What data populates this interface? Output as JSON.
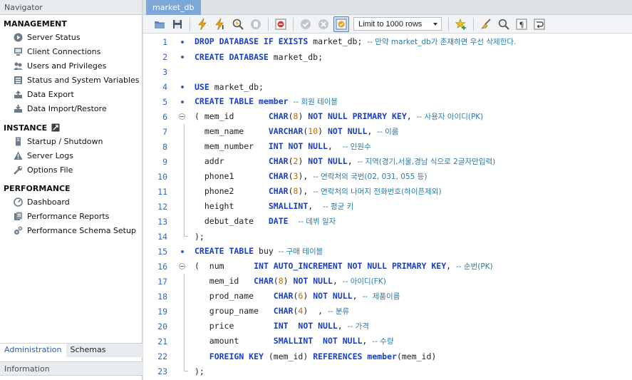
{
  "navigator": {
    "title": "Navigator",
    "sections": [
      {
        "label": "MANAGEMENT",
        "items": [
          {
            "label": "Server Status",
            "icon": "play-icon"
          },
          {
            "label": "Client Connections",
            "icon": "monitor-icon"
          },
          {
            "label": "Users and Privileges",
            "icon": "users-icon"
          },
          {
            "label": "Status and System Variables",
            "icon": "list-icon"
          },
          {
            "label": "Data Export",
            "icon": "export-icon"
          },
          {
            "label": "Data Import/Restore",
            "icon": "import-icon"
          }
        ]
      },
      {
        "label": "INSTANCE",
        "items": [
          {
            "label": "Startup / Shutdown",
            "icon": "server-icon"
          },
          {
            "label": "Server Logs",
            "icon": "warning-icon"
          },
          {
            "label": "Options File",
            "icon": "wrench-icon"
          }
        ]
      },
      {
        "label": "PERFORMANCE",
        "items": [
          {
            "label": "Dashboard",
            "icon": "dashboard-icon"
          },
          {
            "label": "Performance Reports",
            "icon": "reports-icon"
          },
          {
            "label": "Performance Schema Setup",
            "icon": "gears-icon"
          }
        ]
      }
    ],
    "tabs": [
      "Administration",
      "Schemas"
    ],
    "info_label": "Information"
  },
  "editor": {
    "tab_label": "market_db",
    "limit": {
      "selected": "Limit to 1000 rows"
    },
    "lines": [
      {
        "n": 1,
        "seg": [
          [
            "kw",
            "DROP DATABASE IF EXISTS"
          ],
          [
            "t",
            " market_db; "
          ],
          [
            "cm",
            "-- 만약 market_db가 존재하면 우선 삭제한다."
          ]
        ]
      },
      {
        "n": 2,
        "seg": [
          [
            "kw",
            "CREATE DATABASE"
          ],
          [
            "t",
            " market_db;"
          ]
        ]
      },
      {
        "n": 3,
        "seg": []
      },
      {
        "n": 4,
        "seg": [
          [
            "kw",
            "USE"
          ],
          [
            "t",
            " market_db;"
          ]
        ]
      },
      {
        "n": 5,
        "seg": [
          [
            "kw",
            "CREATE TABLE"
          ],
          [
            "t",
            " "
          ],
          [
            "kw",
            "member"
          ],
          [
            "t",
            " "
          ],
          [
            "cm",
            "-- 회원 테이블"
          ]
        ]
      },
      {
        "n": 6,
        "seg": [
          [
            "t",
            "( mem_id       "
          ],
          [
            "kw",
            "CHAR"
          ],
          [
            "t",
            "("
          ],
          [
            "num",
            "8"
          ],
          [
            "t",
            ") "
          ],
          [
            "kw",
            "NOT NULL PRIMARY KEY"
          ],
          [
            "t",
            ", "
          ],
          [
            "cm",
            "-- 사용자 아이디(PK)"
          ]
        ]
      },
      {
        "n": 7,
        "seg": [
          [
            "t",
            "  mem_name     "
          ],
          [
            "kw",
            "VARCHAR"
          ],
          [
            "t",
            "("
          ],
          [
            "num",
            "10"
          ],
          [
            "t",
            ") "
          ],
          [
            "kw",
            "NOT NULL"
          ],
          [
            "t",
            ", "
          ],
          [
            "cm",
            "-- 이름"
          ]
        ]
      },
      {
        "n": 8,
        "seg": [
          [
            "t",
            "  mem_number   "
          ],
          [
            "kw",
            "INT NOT NULL"
          ],
          [
            "t",
            ",  "
          ],
          [
            "cm",
            "-- 인원수"
          ]
        ]
      },
      {
        "n": 9,
        "seg": [
          [
            "t",
            "  addr         "
          ],
          [
            "kw",
            "CHAR"
          ],
          [
            "t",
            "("
          ],
          [
            "num",
            "2"
          ],
          [
            "t",
            ") "
          ],
          [
            "kw",
            "NOT NULL"
          ],
          [
            "t",
            ", "
          ],
          [
            "cm",
            "-- 지역(경기,서울,경남 식으로 2글자만입력)"
          ]
        ]
      },
      {
        "n": 10,
        "seg": [
          [
            "t",
            "  phone1       "
          ],
          [
            "kw",
            "CHAR"
          ],
          [
            "t",
            "("
          ],
          [
            "num",
            "3"
          ],
          [
            "t",
            "), "
          ],
          [
            "cm",
            "-- 연락처의 국번(02, 031, 055 등)"
          ]
        ]
      },
      {
        "n": 11,
        "seg": [
          [
            "t",
            "  phone2       "
          ],
          [
            "kw",
            "CHAR"
          ],
          [
            "t",
            "("
          ],
          [
            "num",
            "8"
          ],
          [
            "t",
            "), "
          ],
          [
            "cm",
            "-- 연락처의 나머지 전화번호(하이픈제외)"
          ]
        ]
      },
      {
        "n": 12,
        "seg": [
          [
            "t",
            "  height       "
          ],
          [
            "kw",
            "SMALLINT"
          ],
          [
            "t",
            ",  "
          ],
          [
            "cm",
            "-- 평균 키"
          ]
        ]
      },
      {
        "n": 13,
        "seg": [
          [
            "t",
            "  debut_date   "
          ],
          [
            "kw",
            "DATE"
          ],
          [
            "t",
            "  "
          ],
          [
            "cm",
            "-- 데뷔 일자"
          ]
        ]
      },
      {
        "n": 14,
        "seg": [
          [
            "t",
            ");"
          ]
        ]
      },
      {
        "n": 15,
        "seg": [
          [
            "kw",
            "CREATE TABLE"
          ],
          [
            "t",
            " buy "
          ],
          [
            "cm",
            "-- 구매 테이블"
          ]
        ]
      },
      {
        "n": 16,
        "seg": [
          [
            "t",
            "(  num      "
          ],
          [
            "kw",
            "INT AUTO_INCREMENT NOT NULL PRIMARY KEY"
          ],
          [
            "t",
            ", "
          ],
          [
            "cm",
            "-- 순번(PK)"
          ]
        ]
      },
      {
        "n": 17,
        "seg": [
          [
            "t",
            "   mem_id   "
          ],
          [
            "kw",
            "CHAR"
          ],
          [
            "t",
            "("
          ],
          [
            "num",
            "8"
          ],
          [
            "t",
            ") "
          ],
          [
            "kw",
            "NOT NULL"
          ],
          [
            "t",
            ", "
          ],
          [
            "cm",
            "-- 아이디(FK)"
          ]
        ]
      },
      {
        "n": 18,
        "seg": [
          [
            "t",
            "   prod_name    "
          ],
          [
            "kw",
            "CHAR"
          ],
          [
            "t",
            "("
          ],
          [
            "num",
            "6"
          ],
          [
            "t",
            ") "
          ],
          [
            "kw",
            "NOT NULL"
          ],
          [
            "t",
            ", "
          ],
          [
            "cm",
            "--  제품이름"
          ]
        ]
      },
      {
        "n": 19,
        "seg": [
          [
            "t",
            "   group_name   "
          ],
          [
            "kw",
            "CHAR"
          ],
          [
            "t",
            "("
          ],
          [
            "num",
            "4"
          ],
          [
            "t",
            ")  , "
          ],
          [
            "cm",
            "-- 분류"
          ]
        ]
      },
      {
        "n": 20,
        "seg": [
          [
            "t",
            "   price        "
          ],
          [
            "kw",
            "INT  NOT NULL"
          ],
          [
            "t",
            ", "
          ],
          [
            "cm",
            "-- 가격"
          ]
        ]
      },
      {
        "n": 21,
        "seg": [
          [
            "t",
            "   amount       "
          ],
          [
            "kw",
            "SMALLINT  NOT NULL"
          ],
          [
            "t",
            ", "
          ],
          [
            "cm",
            "-- 수량"
          ]
        ]
      },
      {
        "n": 22,
        "seg": [
          [
            "t",
            "   "
          ],
          [
            "kw",
            "FOREIGN KEY"
          ],
          [
            "t",
            " (mem_id) "
          ],
          [
            "kw",
            "REFERENCES"
          ],
          [
            "t",
            " "
          ],
          [
            "kw",
            "member"
          ],
          [
            "t",
            "(mem_id)"
          ]
        ]
      },
      {
        "n": 23,
        "seg": [
          [
            "t",
            ");"
          ]
        ]
      }
    ]
  },
  "colors": {
    "accent": "#7da7d9",
    "keyword": "#1a3fc4",
    "comment": "#2a7aaa",
    "number": "#c26b00",
    "line_number": "#2a6ac9"
  }
}
